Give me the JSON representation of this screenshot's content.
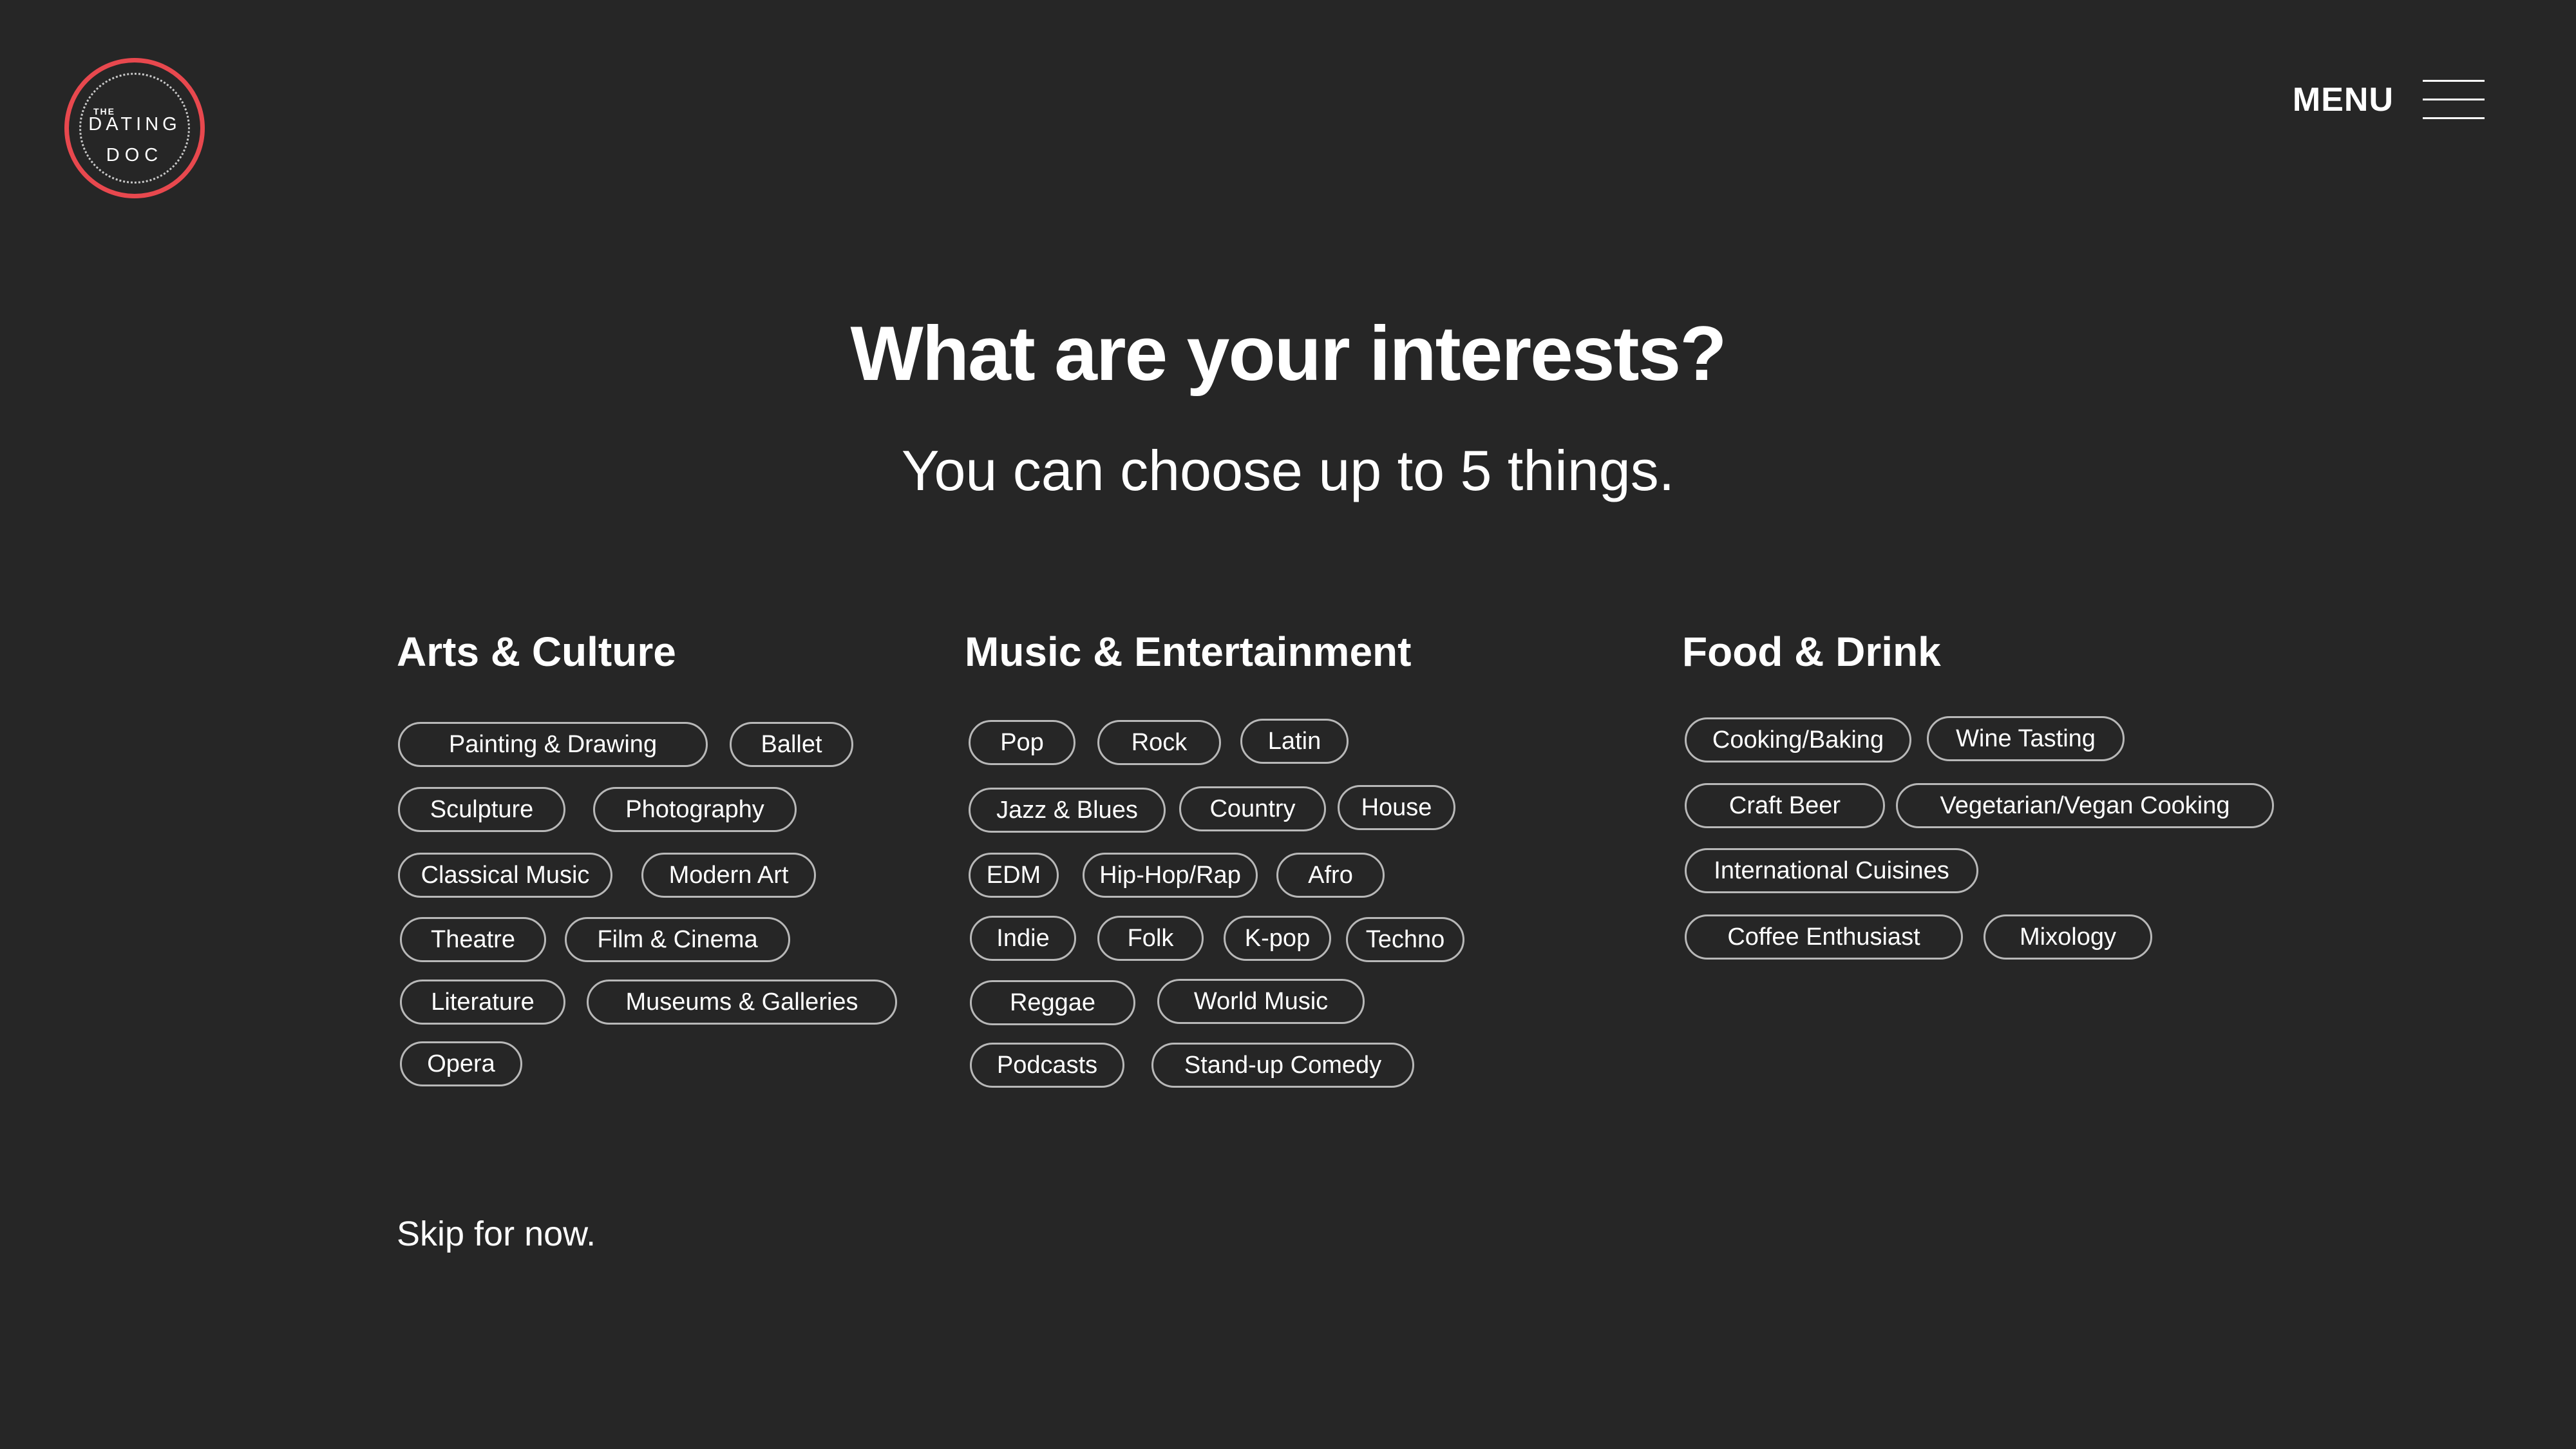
{
  "logo": {
    "the": "THE",
    "dating": "DATING",
    "doc": "DOC",
    "accent_color": "#e8484e"
  },
  "header": {
    "menu_label": "MENU",
    "menu_icon": "hamburger-icon"
  },
  "main": {
    "title": "What are your interests?",
    "subtitle": "You can choose up to 5 things.",
    "skip_label": "Skip for now."
  },
  "categories": {
    "arts": {
      "title": "Arts & Culture",
      "items": [
        "Painting  & Drawing",
        "Ballet",
        "Sculpture",
        "Photography",
        "Classical Music",
        "Modern Art",
        "Theatre",
        "Film & Cinema",
        "Literature",
        "Museums & Galleries",
        "Opera"
      ]
    },
    "music": {
      "title": "Music & Entertainment",
      "items": [
        "Pop",
        "Rock",
        "Latin",
        "Jazz & Blues",
        "Country",
        "House",
        "EDM",
        "Hip-Hop/Rap",
        "Afro",
        "Indie",
        "Folk",
        "K-pop",
        "Techno",
        "Reggae",
        "World Music",
        "Podcasts",
        "Stand-up Comedy"
      ]
    },
    "food": {
      "title": "Food & Drink",
      "items": [
        "Cooking/Baking",
        "Wine Tasting",
        "Craft Beer",
        "Vegetarian/Vegan Cooking",
        "International Cuisines",
        "Coffee Enthusiast",
        "Mixology"
      ]
    }
  },
  "colors": {
    "background": "#262626",
    "pill_border": "#b8b8b8",
    "text": "#ffffff"
  }
}
